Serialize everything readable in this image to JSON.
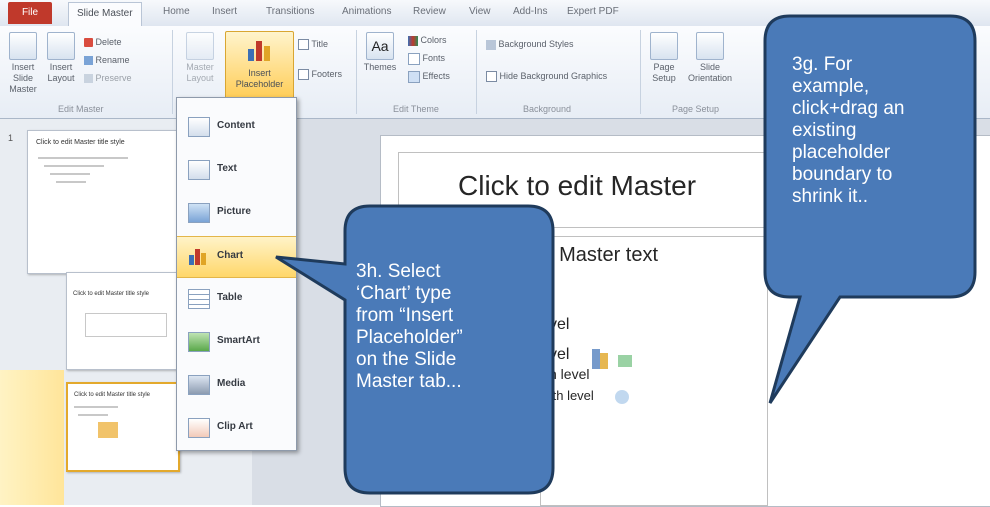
{
  "tabs": [
    "File",
    "Slide Master",
    "Home",
    "Insert",
    "Transitions",
    "Animations",
    "Review",
    "View",
    "Add-Ins",
    "Expert PDF"
  ],
  "ribbon": {
    "insert_slide_master": "Insert Slide Master",
    "insert_layout": "Insert Layout",
    "delete": "Delete",
    "rename": "Rename",
    "preserve": "Preserve",
    "master_layout": "Master Layout",
    "insert_placeholder": "Insert Placeholder",
    "title": "Title",
    "footers": "Footers",
    "themes": "Themes",
    "colors": "Colors",
    "fonts": "Fonts",
    "effects": "Effects",
    "background_styles": "Background Styles",
    "hide_background_graphics": "Hide Background Graphics",
    "page_setup": "Page Setup",
    "slide_orientation": "Slide Orientation",
    "groups": {
      "edit_master": "Edit Master",
      "edit_theme": "Edit Theme",
      "background": "Background",
      "page_setup": "Page Setup"
    }
  },
  "menu": {
    "items": [
      {
        "label": "Content",
        "icon": "content-placeholder-icon"
      },
      {
        "label": "Text",
        "icon": "text-placeholder-icon"
      },
      {
        "label": "Picture",
        "icon": "picture-placeholder-icon"
      },
      {
        "label": "Chart",
        "icon": "chart-placeholder-icon"
      },
      {
        "label": "Table",
        "icon": "table-placeholder-icon"
      },
      {
        "label": "SmartArt",
        "icon": "smartart-placeholder-icon"
      },
      {
        "label": "Media",
        "icon": "media-placeholder-icon"
      },
      {
        "label": "Clip Art",
        "icon": "clipart-placeholder-icon"
      }
    ],
    "highlighted": "Chart"
  },
  "thumbnails": {
    "t1_title": "Click to edit Master title style",
    "t2_title": "Click to edit Master title style",
    "t3_title": "Click to edit Master title style"
  },
  "slide": {
    "title": "Click to edit Master",
    "body": "t Master text",
    "level2": "vel",
    "level3": "vel",
    "level4": "h level",
    "level5": "fth level"
  },
  "callouts": {
    "left": [
      "3h. Select",
      "‘Chart’ type",
      "from “Insert",
      "Placeholder”",
      "on the Slide",
      "Master tab..."
    ],
    "right": [
      "3g. For",
      "example,",
      "click+drag an",
      "existing",
      "placeholder",
      "boundary to",
      "shrink it.."
    ]
  },
  "colors": {
    "callout_fill": "#4a7ab8",
    "callout_stroke": "#1f3b5c",
    "highlight": "#ffd76a",
    "file_tab": "#c0392b"
  }
}
